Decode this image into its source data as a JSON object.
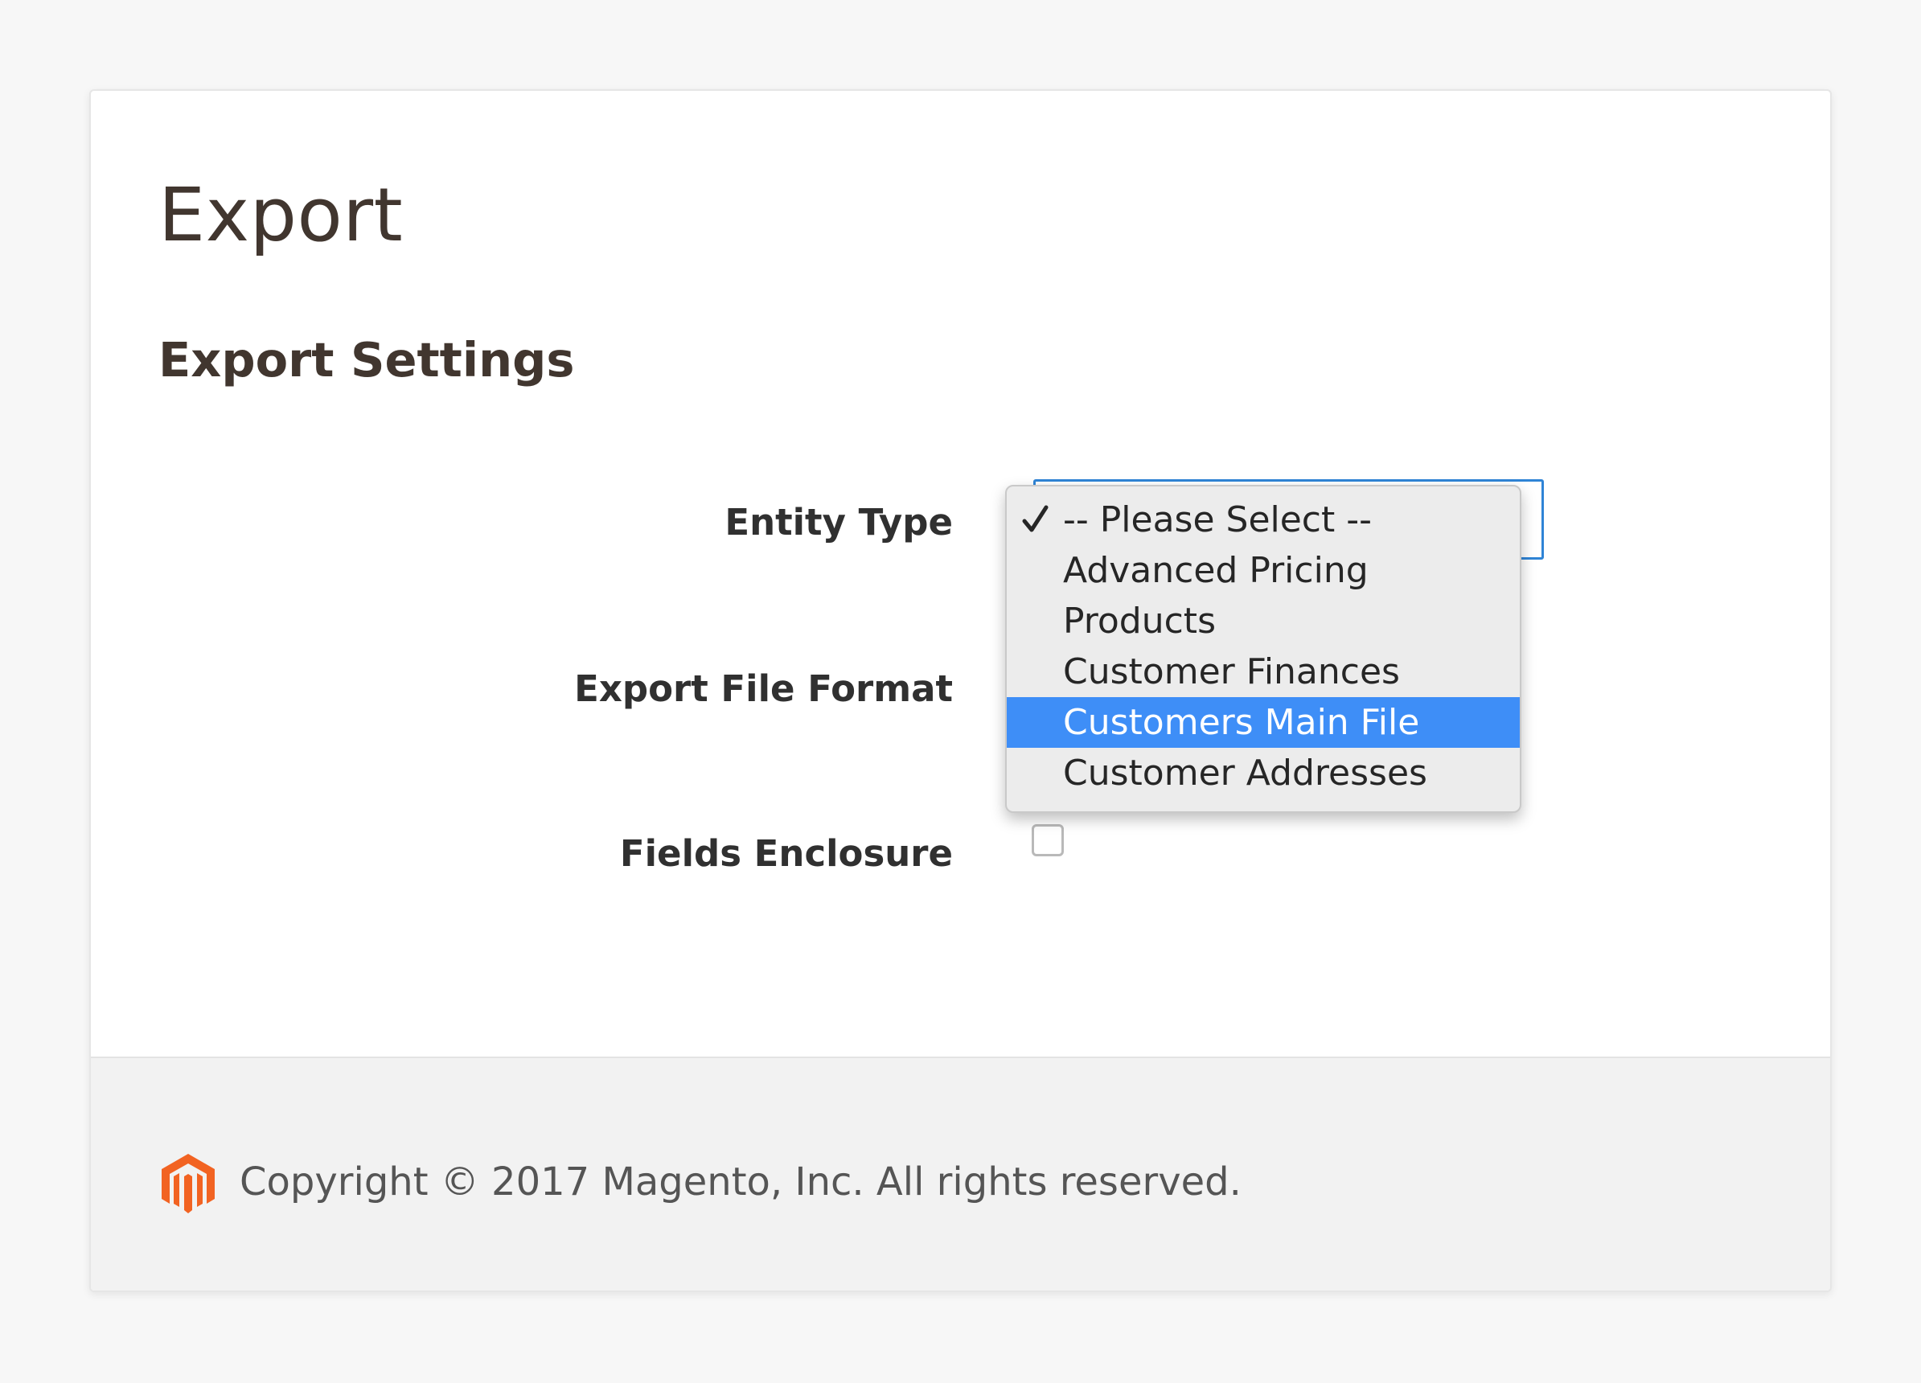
{
  "page": {
    "title": "Export"
  },
  "export_settings": {
    "section_title": "Export Settings",
    "fields": {
      "entity_type_label": "Entity Type",
      "export_file_format_label": "Export File Format",
      "fields_enclosure_label": "Fields Enclosure",
      "fields_enclosure_checked": false
    }
  },
  "entity_type_dropdown": {
    "selected_option": "-- Please Select --",
    "highlighted_option": "Customers Main File",
    "options": [
      "-- Please Select --",
      "Advanced Pricing",
      "Products",
      "Customer Finances",
      "Customers Main File",
      "Customer Addresses"
    ]
  },
  "footer": {
    "logo_icon": "magento-logo-icon",
    "copyright": "Copyright © 2017 Magento, Inc. All rights reserved."
  },
  "colors": {
    "accent_blue": "#3e8ef7",
    "select_border": "#2f84d6",
    "brand_orange": "#f26322",
    "heading_brown": "#41362f"
  }
}
